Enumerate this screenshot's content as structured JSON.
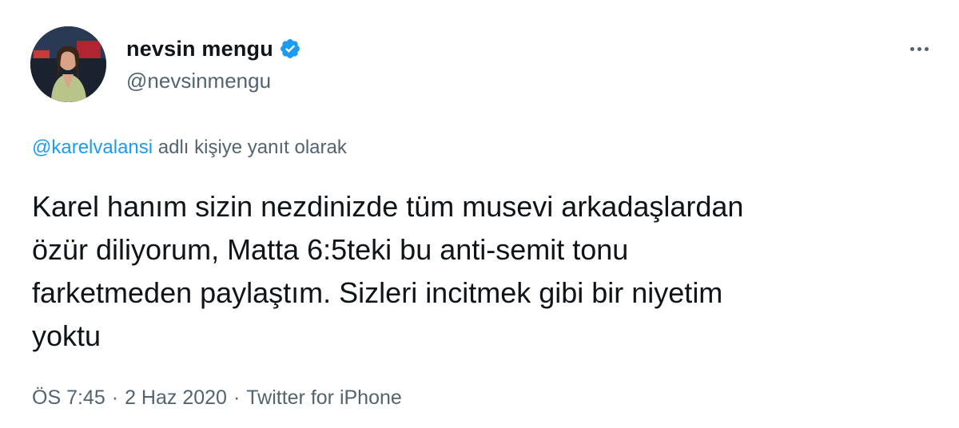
{
  "tweet": {
    "author": {
      "display_name": "nevsin mengu",
      "handle": "@nevsinmengu",
      "verified": true,
      "verified_icon": "verified-badge-icon",
      "avatar_icon": "profile-photo"
    },
    "more_icon": "more-horizontal-icon",
    "reply_context": {
      "mention": "@karelvalansi",
      "suffix": " adlı kişiye yanıt olarak"
    },
    "text": "Karel hanım sizin nezdinizde tüm musevi arkadaşlardan\nözür diliyorum, Matta 6:5teki bu anti-semit tonu\nfarketmeden paylaştım. Sizleri incitmek gibi bir niyetim\nyoktu",
    "meta": {
      "time": "ÖS 7:45",
      "separator": "·",
      "date": "2 Haz 2020",
      "source": "Twitter for iPhone"
    }
  },
  "colors": {
    "accent": "#1d9bf0",
    "text_primary": "#0f1419",
    "text_secondary": "#536471",
    "background": "#ffffff"
  }
}
